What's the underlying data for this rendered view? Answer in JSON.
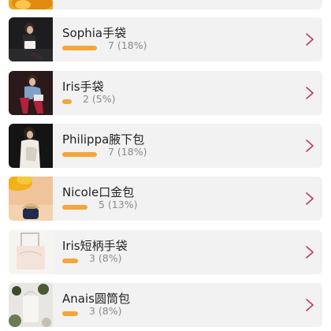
{
  "colors": {
    "bar": "#f5a53b",
    "chevron": "#c0356a",
    "row_bg": "#f2f2f2"
  },
  "items": [
    {
      "name": "",
      "votes": null,
      "percent": null,
      "count_label": "",
      "thumb": "top-partial-yellow"
    },
    {
      "name": "Sophia手袋",
      "votes": 7,
      "percent": 18,
      "count_label": "7 (18%)",
      "thumb": "sophia"
    },
    {
      "name": "Iris手袋",
      "votes": 2,
      "percent": 5,
      "count_label": "2 (5%)",
      "thumb": "iris"
    },
    {
      "name": "Philippa腋下包",
      "votes": 7,
      "percent": 18,
      "count_label": "7 (18%)",
      "thumb": "philippa"
    },
    {
      "name": "Nicole口金包",
      "votes": 5,
      "percent": 13,
      "count_label": "5 (13%)",
      "thumb": "nicole"
    },
    {
      "name": "Iris短柄手袋",
      "votes": 3,
      "percent": 8,
      "count_label": "3 (8%)",
      "thumb": "iris-short"
    },
    {
      "name": "Anais圆筒包",
      "votes": 3,
      "percent": 8,
      "count_label": "3 (8%)",
      "thumb": "anais"
    }
  ],
  "chevron_icon": "chevron-right-icon"
}
